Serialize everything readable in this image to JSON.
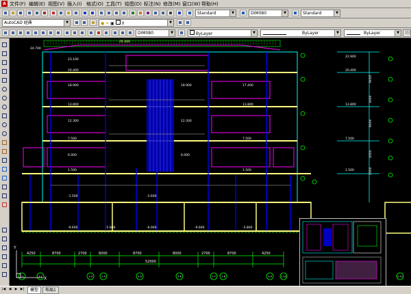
{
  "menubar": {
    "items": [
      "文件(F)",
      "编辑(E)",
      "视图(V)",
      "插入(I)",
      "格式(O)",
      "工具(T)",
      "绘图(D)",
      "标注(N)",
      "修改(M)",
      "窗口(W)",
      "帮助(H)"
    ]
  },
  "toolbar1": {
    "text_style": "Standard",
    "dim_style": "DIM080",
    "table_style": "Standard"
  },
  "toolbar2": {
    "workspace": "AutoCAD 经典",
    "layer_value": "0"
  },
  "toolbar3": {
    "dim_style": "DIM080",
    "color": "ByLayer",
    "linetype": "ByLayer",
    "lineweight": "ByLayer",
    "plot_style": "随颜色"
  },
  "drawing": {
    "elevations": [
      "24.700",
      "23.100",
      "22.900",
      "20.400",
      "18.900",
      "17.400",
      "15.900",
      "13.800",
      "12.300",
      "10.800",
      "9.300",
      "7.500",
      "6.000",
      "4.500",
      "1.500",
      "-1.500",
      "-3.600",
      "-5.800",
      "-6.000",
      "-9.600"
    ],
    "dims_bottom": [
      "4250",
      "8700",
      "2700",
      "6000",
      "8700",
      "8000",
      "2700",
      "8700",
      "4250"
    ],
    "total_dim": "52000",
    "axis_labels": [
      "1-1",
      "1-2",
      "1-3",
      "1-4",
      "1-5",
      "1-6",
      "1-7",
      "1-8",
      "1-9",
      "1-10",
      "1-11"
    ],
    "right_dims": [
      "1500",
      "4500",
      "6000",
      "3000",
      "6000"
    ],
    "top_dim": "25.300",
    "ucs_x": "X",
    "ucs_y": "Y"
  },
  "status": {
    "tabs": [
      "模型",
      "布局1"
    ],
    "active_tab": "模型"
  },
  "colors": {
    "canvas": "#000000",
    "cyan": "#00ffff",
    "yellow": "#ffff80",
    "green": "#00ff00",
    "magenta": "#ff00ff",
    "blue": "#0000ff",
    "white": "#ffffff"
  }
}
